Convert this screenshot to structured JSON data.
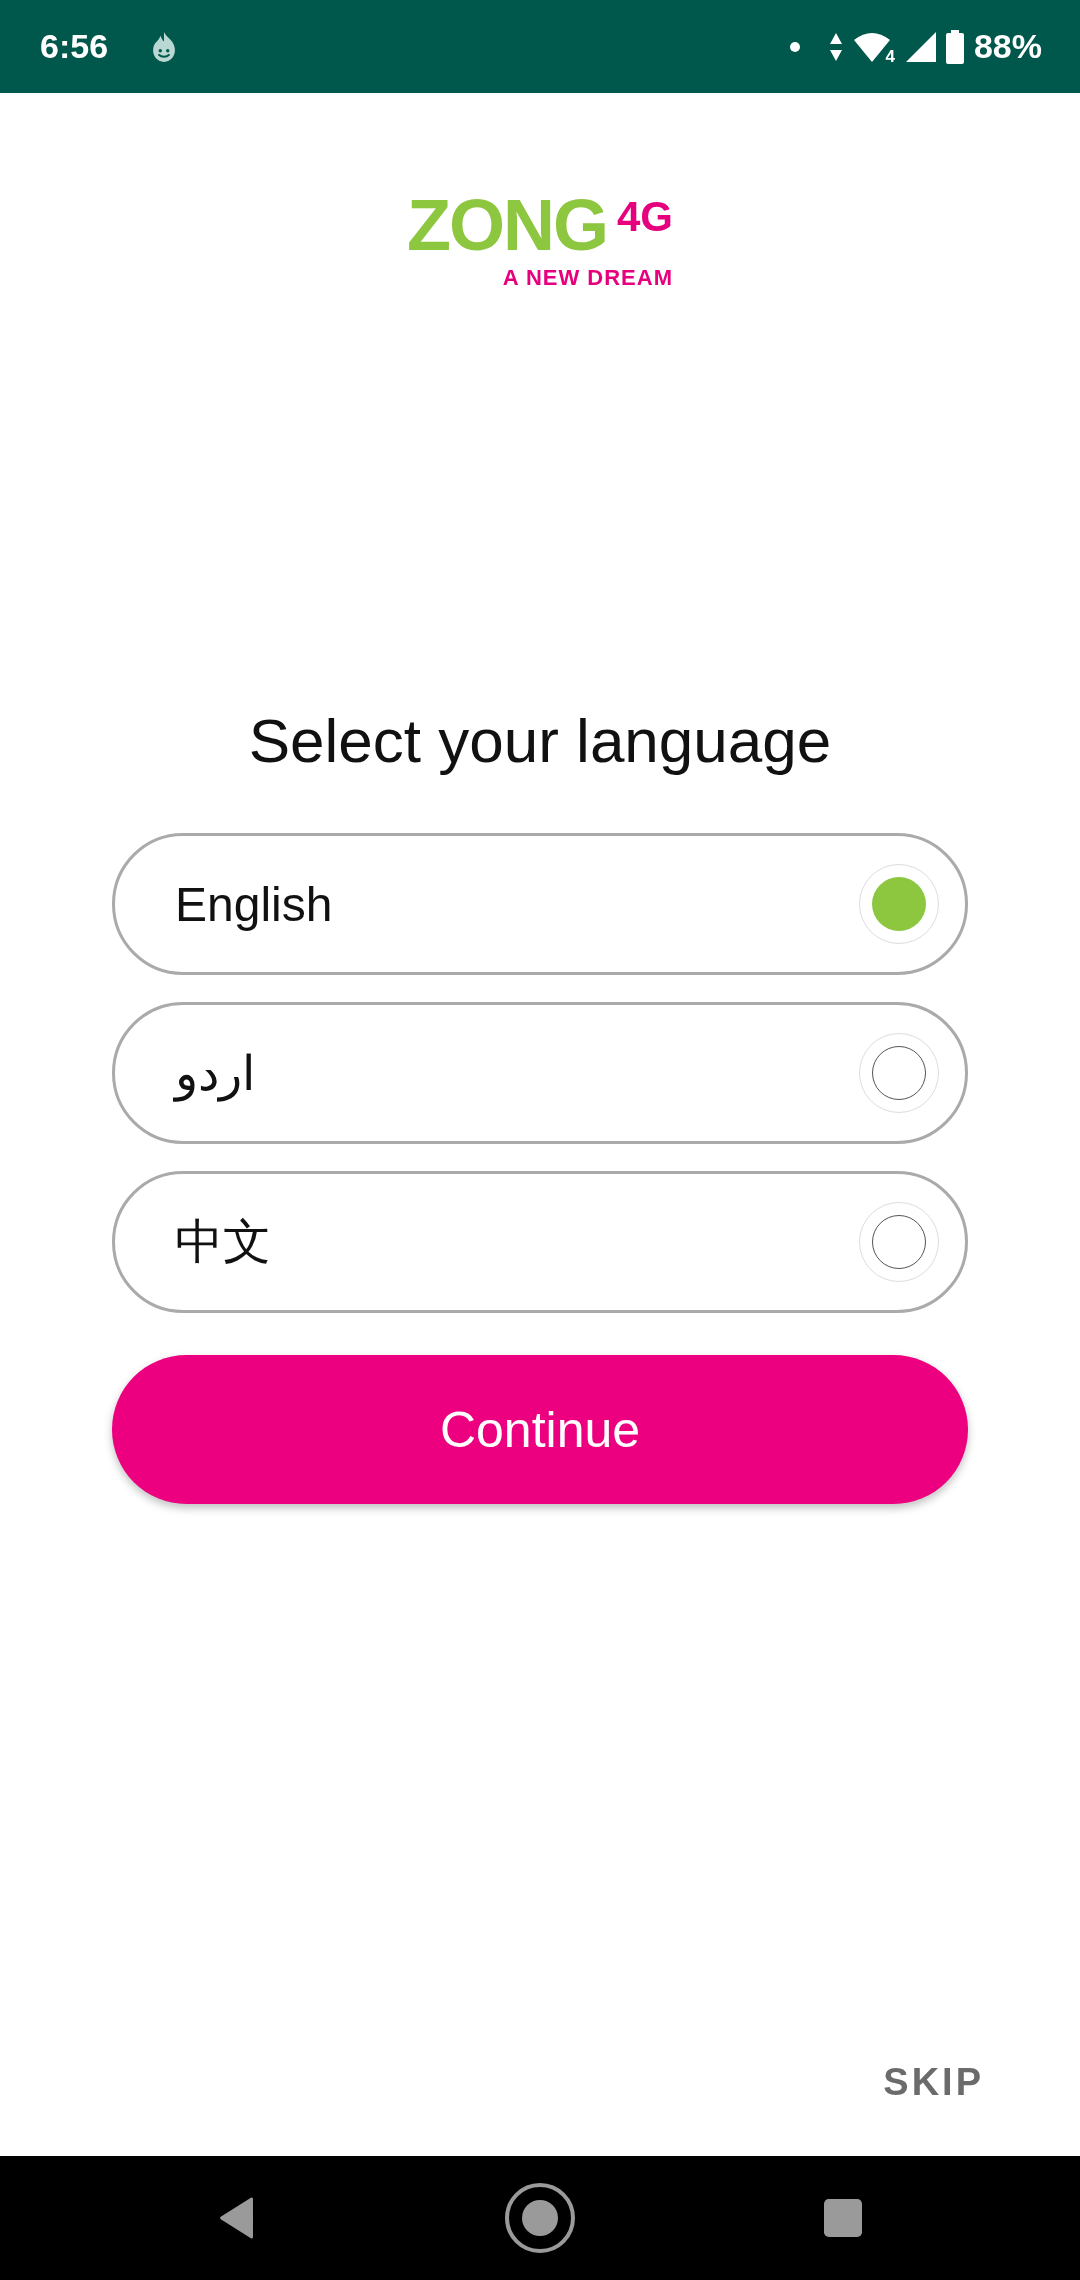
{
  "status_bar": {
    "time": "6:56",
    "network_badge": "4",
    "battery": "88%"
  },
  "logo": {
    "brand": "ZONG",
    "badge": "4G",
    "tagline": "A NEW DREAM"
  },
  "title": "Select your language",
  "languages": [
    {
      "label": "English",
      "selected": true
    },
    {
      "label": "اردو",
      "selected": false
    },
    {
      "label": "中文",
      "selected": false
    }
  ],
  "continue_button": "Continue",
  "skip_button": "SKIP"
}
